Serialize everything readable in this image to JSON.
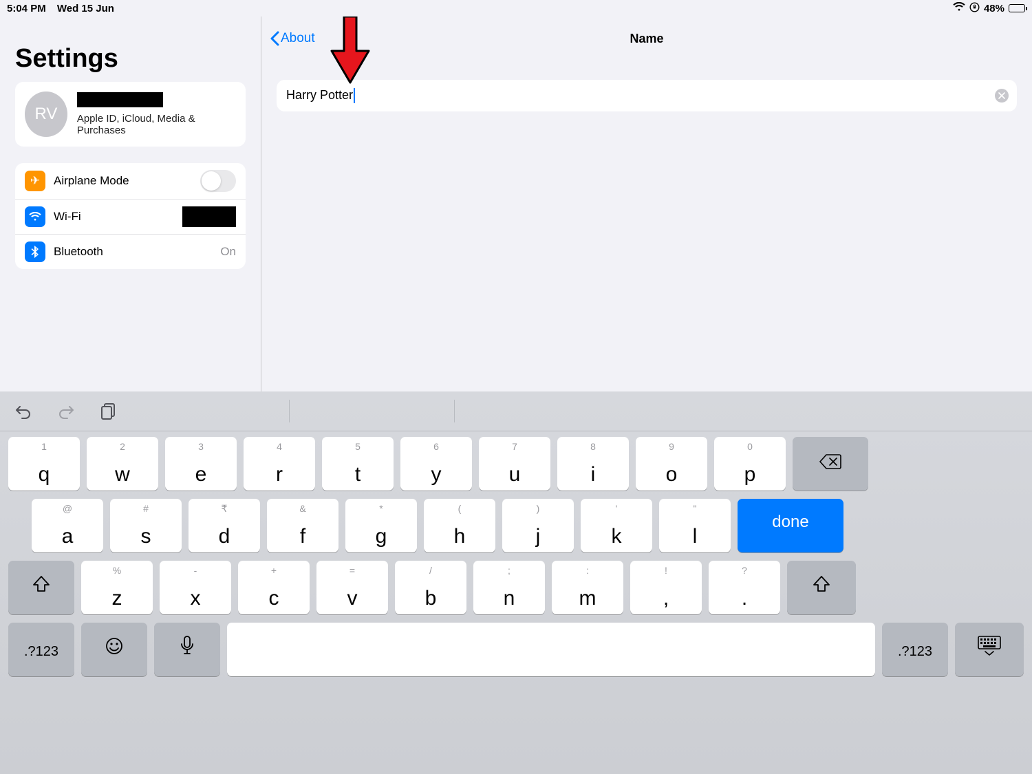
{
  "status": {
    "time": "5:04 PM",
    "date": "Wed 15 Jun",
    "battery_pct": "48%",
    "battery_fill_pct": 48
  },
  "sidebar": {
    "title": "Settings",
    "account": {
      "initials": "RV",
      "subtitle": "Apple ID, iCloud, Media & Purchases"
    },
    "items": [
      {
        "label": "Airplane Mode"
      },
      {
        "label": "Wi-Fi"
      },
      {
        "label": "Bluetooth",
        "value": "On"
      }
    ]
  },
  "detail": {
    "back_label": "About",
    "title": "Name",
    "field_value": "Harry Potter"
  },
  "keyboard": {
    "row1": [
      {
        "a": "1",
        "m": "q"
      },
      {
        "a": "2",
        "m": "w"
      },
      {
        "a": "3",
        "m": "e"
      },
      {
        "a": "4",
        "m": "r"
      },
      {
        "a": "5",
        "m": "t"
      },
      {
        "a": "6",
        "m": "y"
      },
      {
        "a": "7",
        "m": "u"
      },
      {
        "a": "8",
        "m": "i"
      },
      {
        "a": "9",
        "m": "o"
      },
      {
        "a": "0",
        "m": "p"
      }
    ],
    "row2": [
      {
        "a": "@",
        "m": "a"
      },
      {
        "a": "#",
        "m": "s"
      },
      {
        "a": "₹",
        "m": "d"
      },
      {
        "a": "&",
        "m": "f"
      },
      {
        "a": "*",
        "m": "g"
      },
      {
        "a": "(",
        "m": "h"
      },
      {
        "a": ")",
        "m": "j"
      },
      {
        "a": "'",
        "m": "k"
      },
      {
        "a": "\"",
        "m": "l"
      }
    ],
    "row3": [
      {
        "a": "%",
        "m": "z"
      },
      {
        "a": "-",
        "m": "x"
      },
      {
        "a": "+",
        "m": "c"
      },
      {
        "a": "=",
        "m": "v"
      },
      {
        "a": "/",
        "m": "b"
      },
      {
        "a": ";",
        "m": "n"
      },
      {
        "a": ":",
        "m": "m"
      },
      {
        "a": "!",
        "m": ","
      },
      {
        "a": "?",
        "m": "."
      }
    ],
    "done_label": "done",
    "numkey_label": ".?123"
  }
}
